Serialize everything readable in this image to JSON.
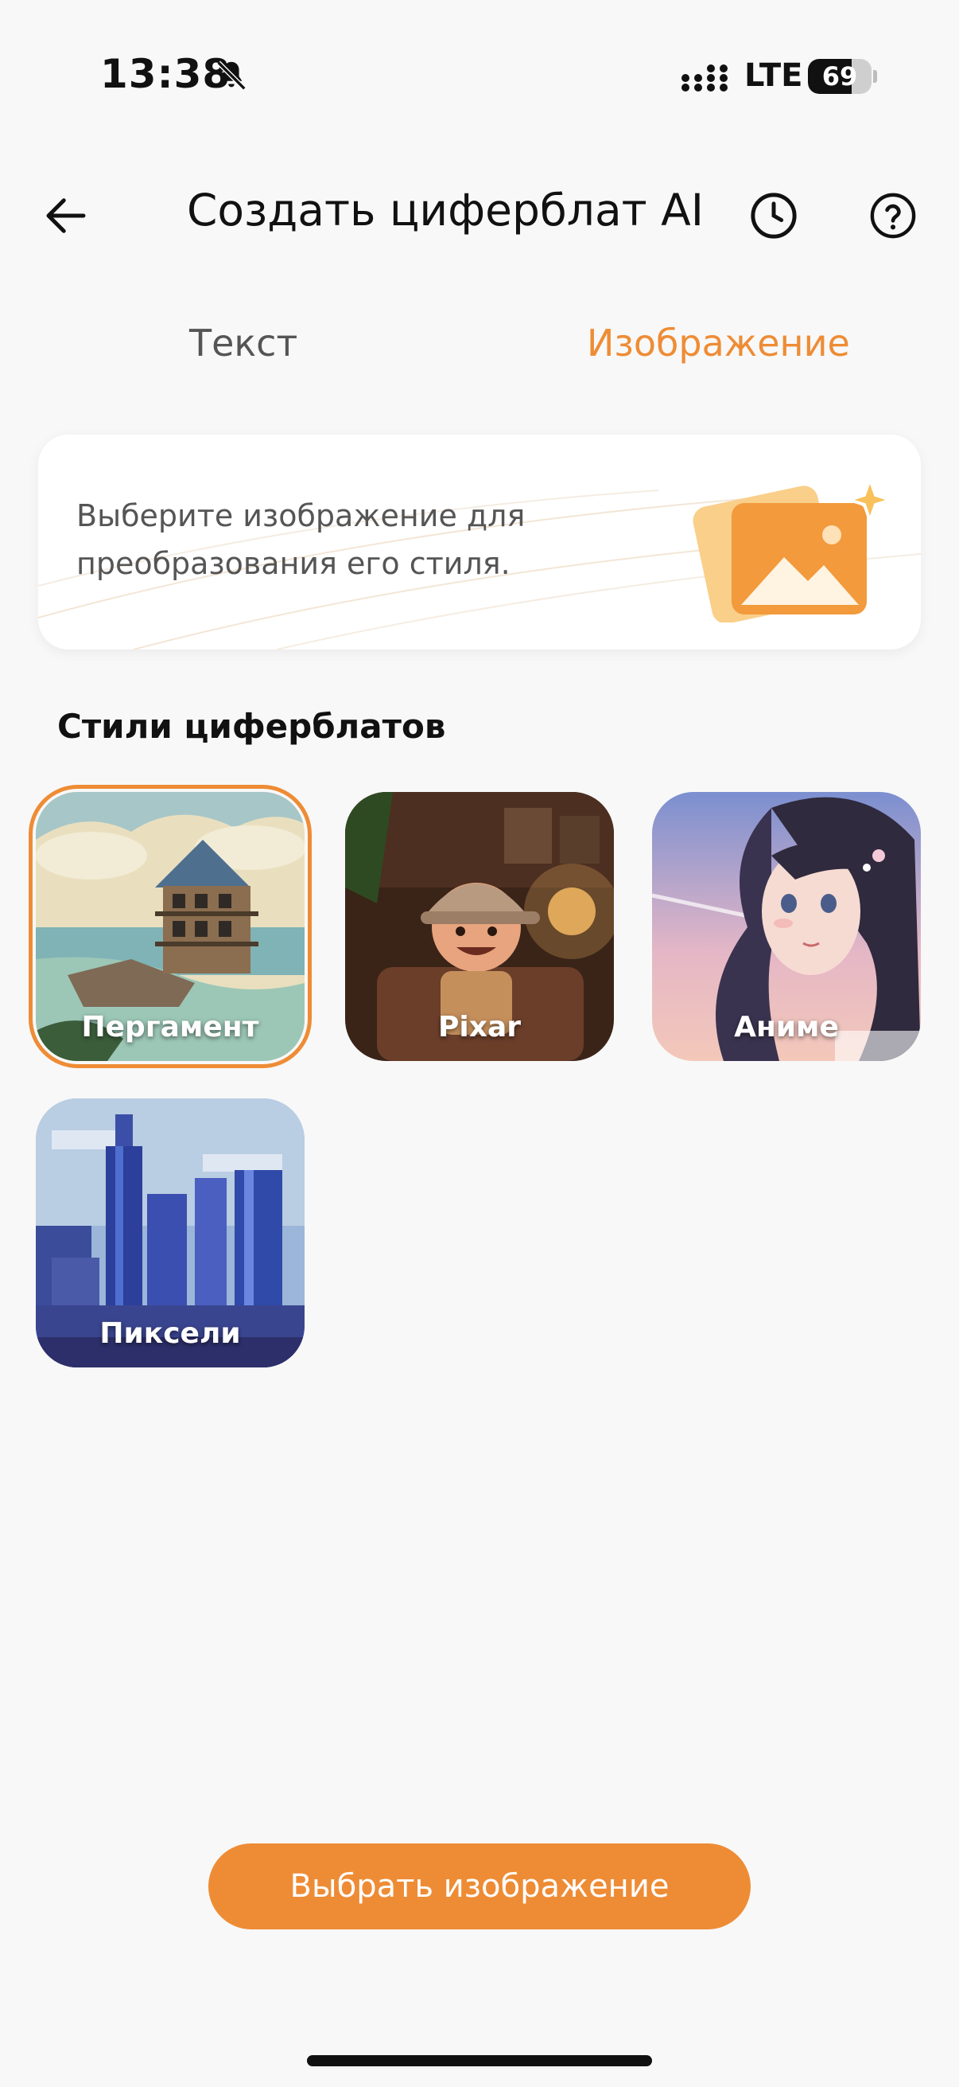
{
  "status_bar": {
    "time": "13:38",
    "network": "LTE",
    "battery_level": "69",
    "battery_fraction": 0.69
  },
  "header": {
    "title": "Создать циферблат AI",
    "icons": [
      "back-arrow-icon",
      "history-clock-icon",
      "help-question-icon"
    ]
  },
  "tabs": [
    {
      "label": "Текст",
      "active": false
    },
    {
      "label": "Изображение",
      "active": true
    }
  ],
  "info_card": {
    "text": "Выберите изображение для преобразования его стиля.",
    "icon": "image-sparkle-icon"
  },
  "styles_section": {
    "title": "Стили циферблатов",
    "items": [
      {
        "label": "Пергамент",
        "selected": true
      },
      {
        "label": "Pixar",
        "selected": false
      },
      {
        "label": "Аниме",
        "selected": false
      },
      {
        "label": "Пиксели",
        "selected": false
      }
    ]
  },
  "primary_button": {
    "label": "Выбрать изображение"
  },
  "colors": {
    "accent": "#ee8c35",
    "background": "#f8f8f8",
    "card": "#ffffff",
    "text_primary": "#111111",
    "text_secondary": "#555555"
  }
}
